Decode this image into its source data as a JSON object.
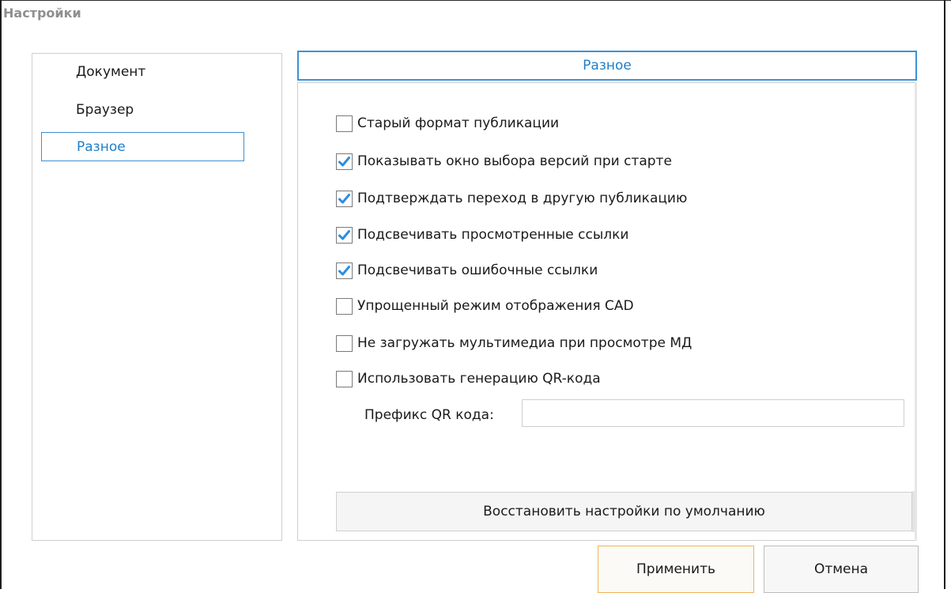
{
  "window": {
    "title": "Настройки"
  },
  "sidebar": {
    "items": [
      {
        "label": "Документ",
        "selected": false
      },
      {
        "label": "Браузер",
        "selected": false
      },
      {
        "label": "Разное",
        "selected": true
      }
    ]
  },
  "section": {
    "title": "Разное"
  },
  "options": [
    {
      "label": "Старый формат публикации",
      "checked": false
    },
    {
      "label": "Показывать окно выбора версий при старте",
      "checked": true
    },
    {
      "label": "Подтверждать переход в другую публикацию",
      "checked": true
    },
    {
      "label": "Подсвечивать просмотренные ссылки",
      "checked": true
    },
    {
      "label": "Подсвечивать ошибочные ссылки",
      "checked": true
    },
    {
      "label": "Упрощенный режим отображения CAD",
      "checked": false
    },
    {
      "label": "Не загружать мультимедиа при просмотре МД",
      "checked": false
    },
    {
      "label": "Использовать генерацию QR-кода",
      "checked": false
    }
  ],
  "qr_prefix": {
    "label": "Префикс QR кода:",
    "value": ""
  },
  "buttons": {
    "restore": "Восстановить настройки по умолчанию",
    "apply": "Применить",
    "cancel": "Отмена"
  },
  "colors": {
    "accent": "#1e7fc9",
    "check": "#2a8ee0",
    "apply_border": "#f2b35a"
  }
}
